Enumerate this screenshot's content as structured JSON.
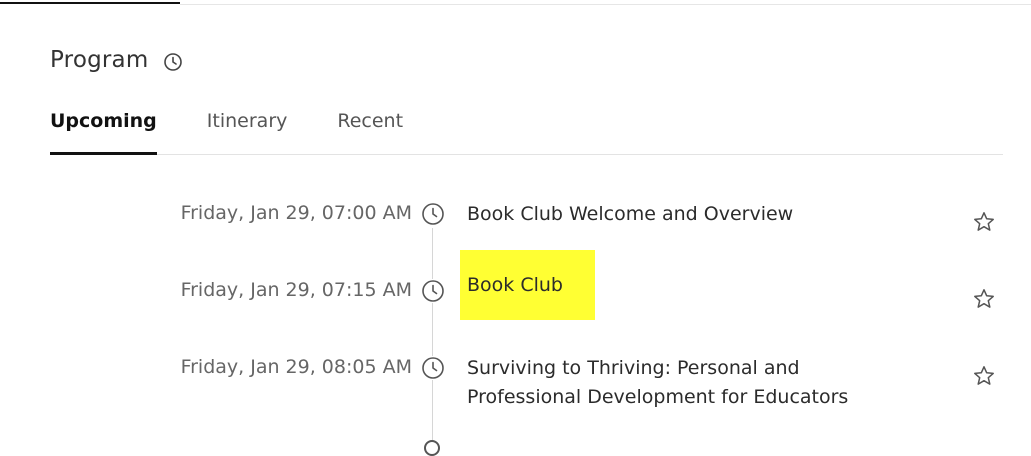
{
  "header": {
    "title": "Program",
    "title_icon": "clock-icon"
  },
  "tabs": [
    {
      "label": "Upcoming",
      "active": true
    },
    {
      "label": "Itinerary",
      "active": false
    },
    {
      "label": "Recent",
      "active": false
    }
  ],
  "events": [
    {
      "date": "Friday, Jan 29, 07:00 AM",
      "title": "Book Club Welcome and Overview",
      "favorite_icon": "star-icon"
    },
    {
      "date": "Friday, Jan 29, 07:15 AM",
      "title": "Book Club",
      "highlighted": true,
      "favorite_icon": "star-icon"
    },
    {
      "date": "Friday, Jan 29, 08:05 AM",
      "title_line1": "Surviving to Thriving: Personal and",
      "title_line2": "Professional Development for Educators",
      "favorite_icon": "star-icon"
    }
  ],
  "colors": {
    "highlight": "#ffff33",
    "active_tab": "#111111",
    "muted_text": "#666666"
  }
}
